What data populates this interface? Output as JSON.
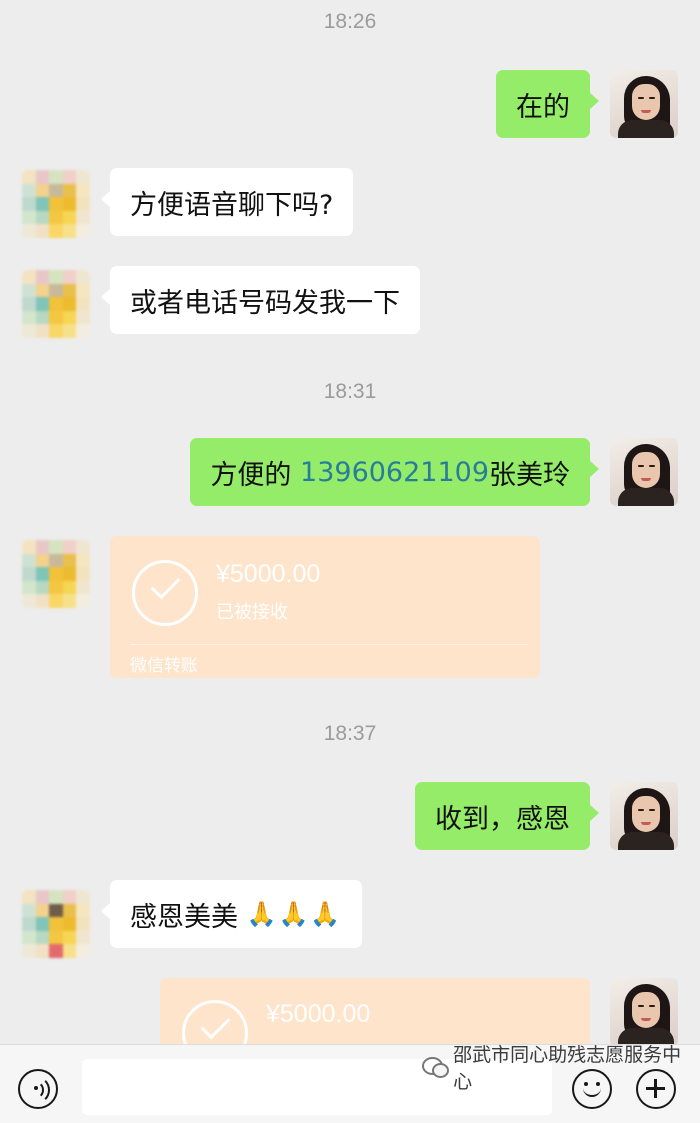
{
  "messages": {
    "time_1": "18:26",
    "sent_1": "在的",
    "recv_1": "方便语音聊下吗?",
    "recv_2": "或者电话号码发我一下",
    "time_2": "18:31",
    "sent_2_prefix": "方便的 ",
    "sent_2_phone": "13960621109",
    "sent_2_suffix": "张美玲",
    "time_3": "18:37",
    "sent_3": "收到，感恩",
    "recv_3_text": "感恩美美 ",
    "recv_3_emoji": "🙏🙏🙏"
  },
  "transfer_1": {
    "amount": "¥5000.00",
    "status": "已被接收",
    "brand": "微信转账"
  },
  "transfer_2": {
    "amount": "¥5000.00"
  },
  "toolbar": {
    "watermark": "邵武市同心助残志愿服务中心"
  },
  "colors": {
    "background": "#ededed",
    "sent_bubble": "#95ec69",
    "received_bubble": "#ffffff",
    "transfer_card": "#fde4cb",
    "phone_link": "#2a7d99"
  }
}
